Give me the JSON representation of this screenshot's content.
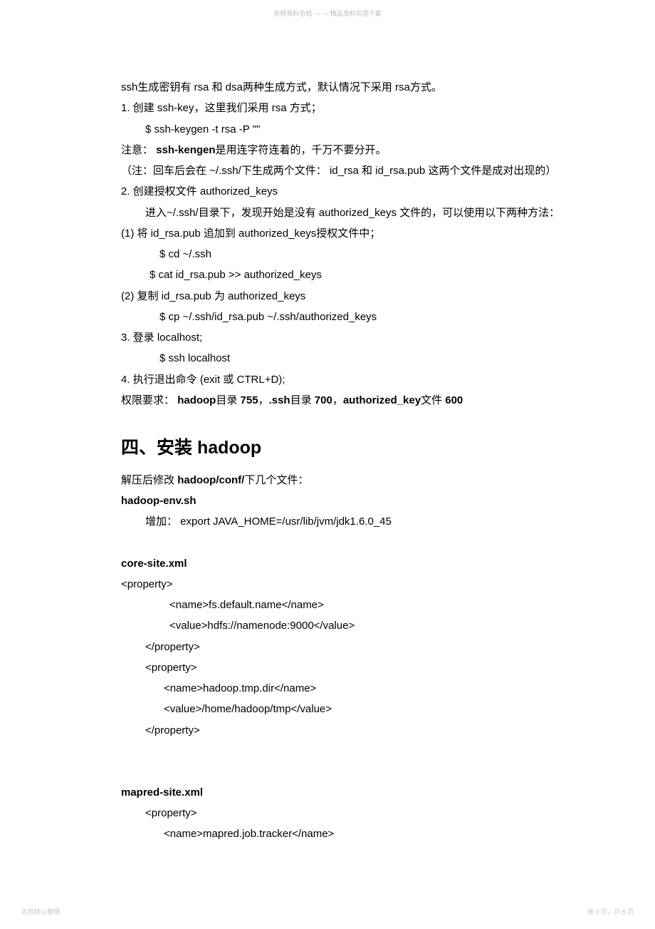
{
  "header_watermark": "名师资料总结 — — 精品资料欢迎下载",
  "body": {
    "p1": "ssh生成密钥有  rsa 和 dsa两种生成方式，默认情况下采用     rsa方式。",
    "p2": "1. 创建  ssh-key，这里我们采用   rsa 方式；",
    "p3": "$ ssh-keygen -t rsa -P \"\"",
    "p4a": "注意：",
    "p4b": "ssh-kengen",
    "p4c": "是用连字符连着的，千万不要分开。",
    "p5": "（注：回车后会在  ~/.ssh/下生成两个文件：   id_rsa 和 id_rsa.pub 这两个文件是成对出现的）",
    "p6": "2. 创建授权文件   authorized_keys",
    "p7": "进入~/.ssh/目录下，发现开始是没有     authorized_keys 文件的，可以使用以下两种方法：",
    "p8": "  (1) 将  id_rsa.pub 追加到  authorized_keys授权文件中；",
    "p9": "$ cd ~/.ssh",
    "p10": "$ cat id_rsa.pub >> authorized_keys",
    "p11": "  (2) 复制   id_rsa.pub  为  authorized_keys",
    "p12": "$ cp ~/.ssh/id_rsa.pub ~/.ssh/authorized_keys",
    "p13": "3. 登录  localhost;",
    "p14": "$ ssh localhost",
    "p15": "4. 执行退出命令 (exit 或 CTRL+D);",
    "p16a": "权限要求：",
    "p16b": "hadoop",
    "p16c": "目录",
    "p16d": "755",
    "p16e": "，",
    "p16f": ".ssh",
    "p16g": "目录",
    "p16h": "700",
    "p16i": "，",
    "p16j": "authorized_key",
    "p16k": "文件",
    "p16l": "600"
  },
  "heading": "四、安装  hadoop",
  "section2": {
    "p1a": "解压后修改",
    "p1b": "hadoop/conf/",
    "p1c": "下几个文件：",
    "p2": "hadoop-env.sh",
    "p3": "增加：  export JAVA_HOME=/usr/lib/jvm/jdk1.6.0_45",
    "p4": "core-site.xml",
    "p5": "<property>",
    "p6": "<name>fs.default.name</name>",
    "p7": "<value>hdfs://namenode:9000</value>",
    "p8": "</property>",
    "p9": "<property>",
    "p10": "<name>hadoop.tmp.dir</name>",
    "p11": "<value>/home/hadoop/tmp</value>",
    "p12": "</property>",
    "p13": "mapred-site.xml",
    "p14": "<property>",
    "p15": "<name>mapred.job.tracker</name>"
  },
  "footer_left": "名师精心整理",
  "footer_right": "第 3 页，共 8 页"
}
